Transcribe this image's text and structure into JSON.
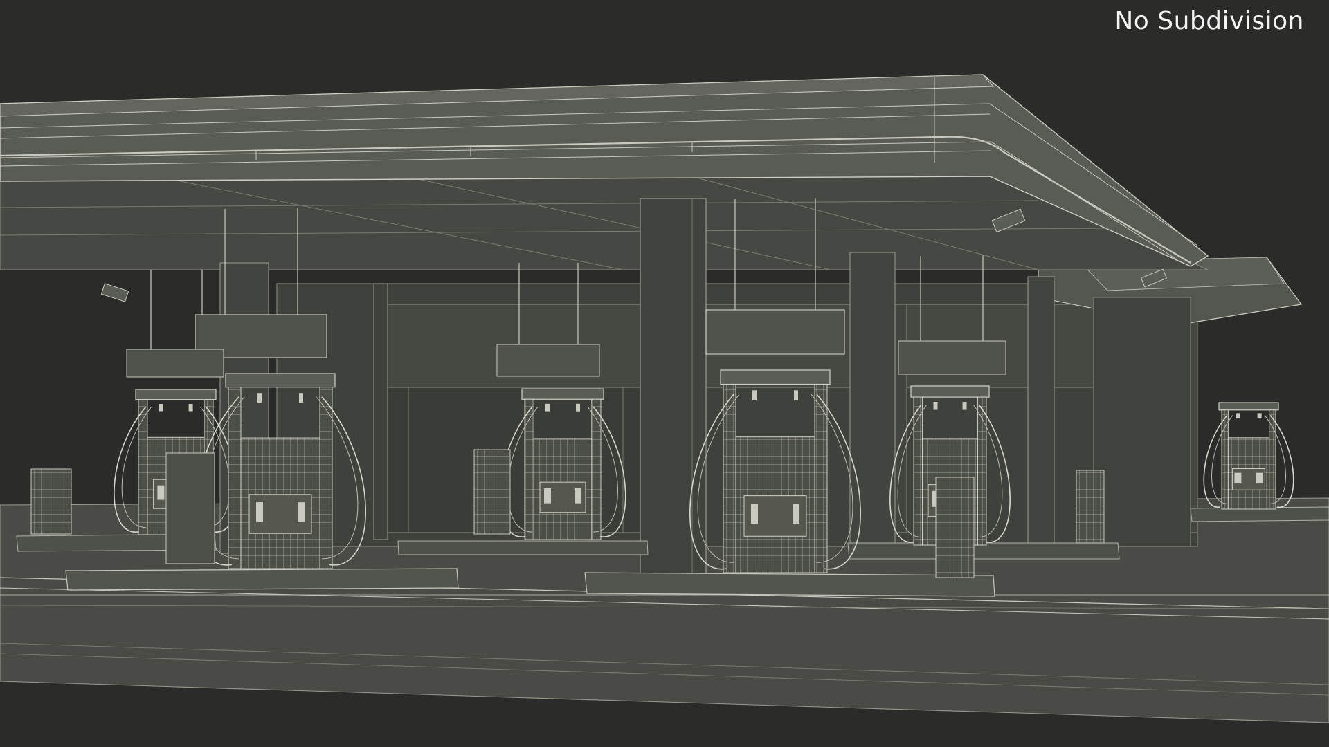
{
  "viewport": {
    "label": "No Subdivision",
    "background_color": "#2b2b2a",
    "wire_color": "#c9c9bf",
    "surface_color": "#41433e"
  },
  "scene": {
    "pump_count": 6,
    "kiosk_count": 5
  }
}
